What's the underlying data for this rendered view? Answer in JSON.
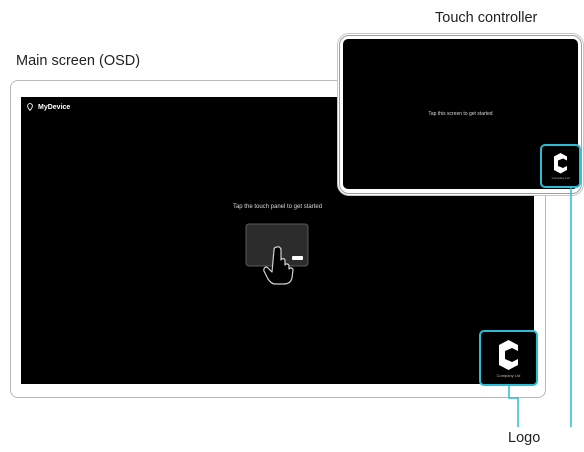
{
  "captions": {
    "main_screen": "Main screen (OSD)",
    "touch_controller": "Touch controller",
    "logo": "Logo"
  },
  "main_screen": {
    "device_name": "MyDevice",
    "prompt": "Tap the touch panel to get started",
    "logo_text": "Company Ltd"
  },
  "touch_controller": {
    "prompt": "Tap this screen to get started",
    "logo_text": "Company Ltd"
  },
  "colors": {
    "highlight": "#2bbcd6",
    "screen": "#000000",
    "frame_border": "#b8b8b8"
  },
  "icons": [
    "location-pin-icon",
    "touch-hand-icon",
    "company-logo-icon"
  ]
}
